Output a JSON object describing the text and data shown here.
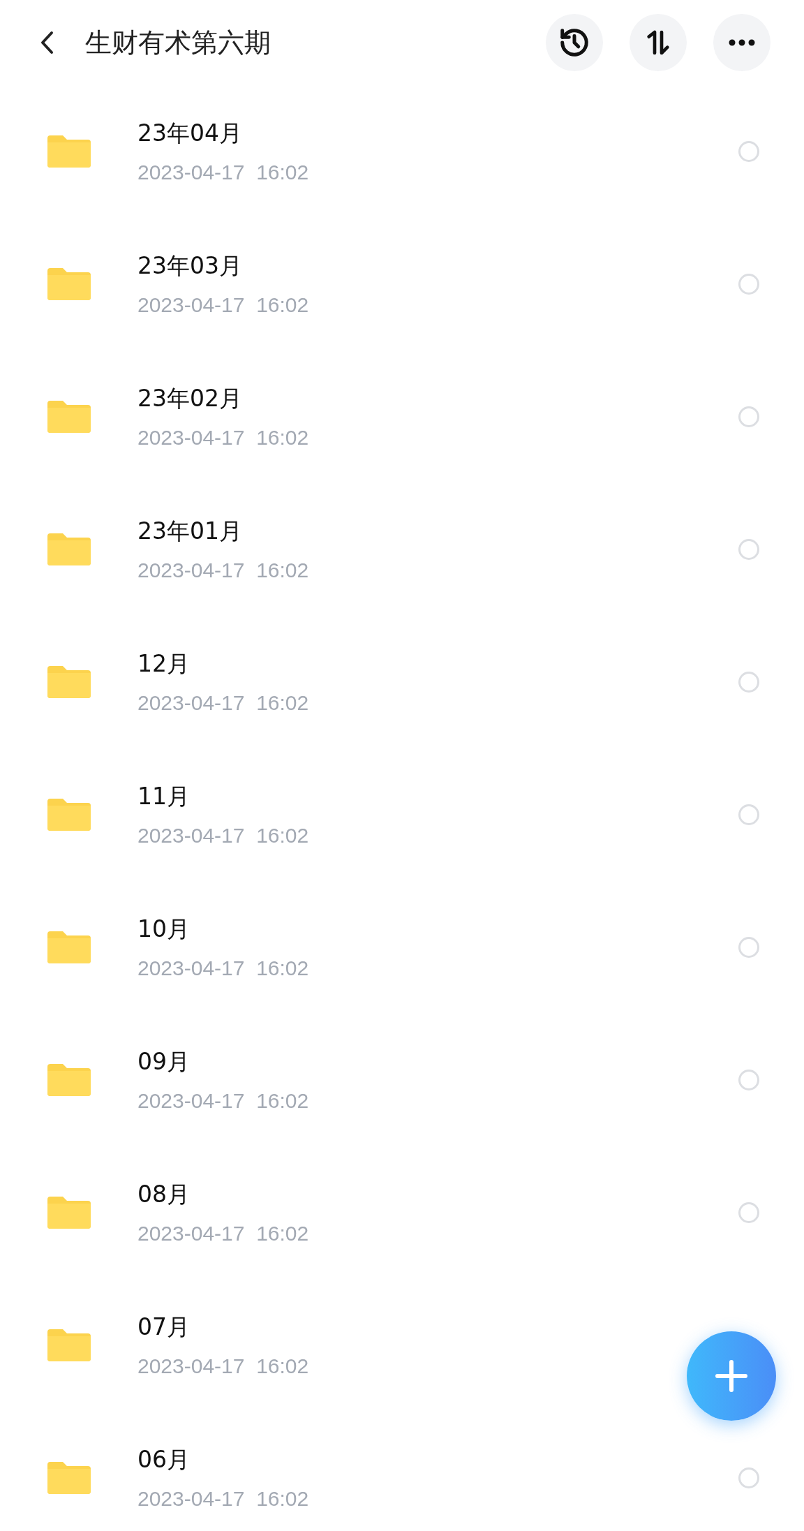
{
  "header": {
    "title": "生财有术第六期"
  },
  "folders": [
    {
      "name": "23年04月",
      "modified": "2023-04-17  16:02",
      "selected": false
    },
    {
      "name": "23年03月",
      "modified": "2023-04-17  16:02",
      "selected": false
    },
    {
      "name": "23年02月",
      "modified": "2023-04-17  16:02",
      "selected": false
    },
    {
      "name": "23年01月",
      "modified": "2023-04-17  16:02",
      "selected": false
    },
    {
      "name": "12月",
      "modified": "2023-04-17  16:02",
      "selected": false
    },
    {
      "name": "11月",
      "modified": "2023-04-17  16:02",
      "selected": false
    },
    {
      "name": "10月",
      "modified": "2023-04-17  16:02",
      "selected": false
    },
    {
      "name": "09月",
      "modified": "2023-04-17  16:02",
      "selected": false
    },
    {
      "name": "08月",
      "modified": "2023-04-17  16:02",
      "selected": false
    },
    {
      "name": "07月",
      "modified": "2023-04-17  16:02"
    },
    {
      "name": "06月",
      "modified": "2023-04-17  16:02",
      "selected": false
    }
  ]
}
